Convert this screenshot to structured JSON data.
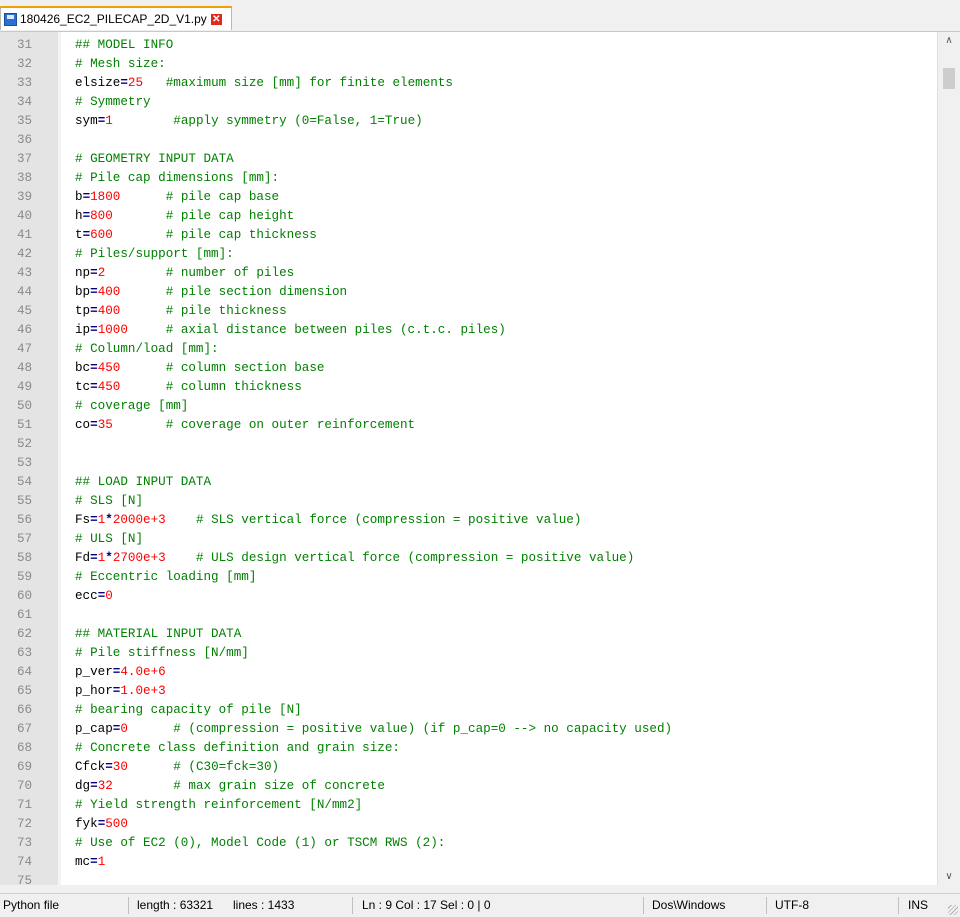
{
  "tab": {
    "filename": "180426_EC2_PILECAP_2D_V1.py"
  },
  "status": {
    "filetype": "Python file",
    "length": "length : 63321",
    "lines": "lines : 1433",
    "position": "Ln : 9    Col : 17    Sel : 0 | 0",
    "eol": "Dos\\Windows",
    "encoding": "UTF-8",
    "mode": "INS"
  },
  "lines": [
    {
      "n": "31",
      "t": [
        [
          "c",
          "## MODEL INFO"
        ]
      ]
    },
    {
      "n": "32",
      "t": [
        [
          "c",
          "# Mesh size:"
        ]
      ]
    },
    {
      "n": "33",
      "t": [
        [
          "t",
          "elsize"
        ],
        [
          "o",
          "="
        ],
        [
          "n",
          "25"
        ],
        [
          "t",
          "   "
        ],
        [
          "c",
          "#maximum size [mm] for finite elements"
        ]
      ]
    },
    {
      "n": "34",
      "t": [
        [
          "c",
          "# Symmetry"
        ]
      ]
    },
    {
      "n": "35",
      "t": [
        [
          "t",
          "sym"
        ],
        [
          "o",
          "="
        ],
        [
          "n",
          "1"
        ],
        [
          "t",
          "        "
        ],
        [
          "c",
          "#apply symmetry (0=False, 1=True)"
        ]
      ]
    },
    {
      "n": "36",
      "t": []
    },
    {
      "n": "37",
      "t": [
        [
          "c",
          "# GEOMETRY INPUT DATA"
        ]
      ]
    },
    {
      "n": "38",
      "t": [
        [
          "c",
          "# Pile cap dimensions [mm]:"
        ]
      ]
    },
    {
      "n": "39",
      "t": [
        [
          "t",
          "b"
        ],
        [
          "o",
          "="
        ],
        [
          "n",
          "1800"
        ],
        [
          "t",
          "      "
        ],
        [
          "c",
          "# pile cap base"
        ]
      ]
    },
    {
      "n": "40",
      "t": [
        [
          "t",
          "h"
        ],
        [
          "o",
          "="
        ],
        [
          "n",
          "800"
        ],
        [
          "t",
          "       "
        ],
        [
          "c",
          "# pile cap height"
        ]
      ]
    },
    {
      "n": "41",
      "t": [
        [
          "t",
          "t"
        ],
        [
          "o",
          "="
        ],
        [
          "n",
          "600"
        ],
        [
          "t",
          "       "
        ],
        [
          "c",
          "# pile cap thickness"
        ]
      ]
    },
    {
      "n": "42",
      "t": [
        [
          "c",
          "# Piles/support [mm]:"
        ]
      ]
    },
    {
      "n": "43",
      "t": [
        [
          "t",
          "np"
        ],
        [
          "o",
          "="
        ],
        [
          "n",
          "2"
        ],
        [
          "t",
          "        "
        ],
        [
          "c",
          "# number of piles"
        ]
      ]
    },
    {
      "n": "44",
      "t": [
        [
          "t",
          "bp"
        ],
        [
          "o",
          "="
        ],
        [
          "n",
          "400"
        ],
        [
          "t",
          "      "
        ],
        [
          "c",
          "# pile section dimension"
        ]
      ]
    },
    {
      "n": "45",
      "t": [
        [
          "t",
          "tp"
        ],
        [
          "o",
          "="
        ],
        [
          "n",
          "400"
        ],
        [
          "t",
          "      "
        ],
        [
          "c",
          "# pile thickness"
        ]
      ]
    },
    {
      "n": "46",
      "t": [
        [
          "t",
          "ip"
        ],
        [
          "o",
          "="
        ],
        [
          "n",
          "1000"
        ],
        [
          "t",
          "     "
        ],
        [
          "c",
          "# axial distance between piles (c.t.c. piles)"
        ]
      ]
    },
    {
      "n": "47",
      "t": [
        [
          "c",
          "# Column/load [mm]:"
        ]
      ]
    },
    {
      "n": "48",
      "t": [
        [
          "t",
          "bc"
        ],
        [
          "o",
          "="
        ],
        [
          "n",
          "450"
        ],
        [
          "t",
          "      "
        ],
        [
          "c",
          "# column section base"
        ]
      ]
    },
    {
      "n": "49",
      "t": [
        [
          "t",
          "tc"
        ],
        [
          "o",
          "="
        ],
        [
          "n",
          "450"
        ],
        [
          "t",
          "      "
        ],
        [
          "c",
          "# column thickness"
        ]
      ]
    },
    {
      "n": "50",
      "t": [
        [
          "c",
          "# coverage [mm]"
        ]
      ]
    },
    {
      "n": "51",
      "t": [
        [
          "t",
          "co"
        ],
        [
          "o",
          "="
        ],
        [
          "n",
          "35"
        ],
        [
          "t",
          "       "
        ],
        [
          "c",
          "# coverage on outer reinforcement"
        ]
      ]
    },
    {
      "n": "52",
      "t": []
    },
    {
      "n": "53",
      "t": []
    },
    {
      "n": "54",
      "t": [
        [
          "c",
          "## LOAD INPUT DATA"
        ]
      ]
    },
    {
      "n": "55",
      "t": [
        [
          "c",
          "# SLS [N]"
        ]
      ]
    },
    {
      "n": "56",
      "t": [
        [
          "t",
          "Fs"
        ],
        [
          "o",
          "="
        ],
        [
          "n",
          "1"
        ],
        [
          "o",
          "*"
        ],
        [
          "n",
          "2000e+3"
        ],
        [
          "t",
          "    "
        ],
        [
          "c",
          "# SLS vertical force (compression = positive value)"
        ]
      ]
    },
    {
      "n": "57",
      "t": [
        [
          "c",
          "# ULS [N]"
        ]
      ]
    },
    {
      "n": "58",
      "t": [
        [
          "t",
          "Fd"
        ],
        [
          "o",
          "="
        ],
        [
          "n",
          "1"
        ],
        [
          "o",
          "*"
        ],
        [
          "n",
          "2700e+3"
        ],
        [
          "t",
          "    "
        ],
        [
          "c",
          "# ULS design vertical force (compression = positive value)"
        ]
      ]
    },
    {
      "n": "59",
      "t": [
        [
          "c",
          "# Eccentric loading [mm]"
        ]
      ]
    },
    {
      "n": "60",
      "t": [
        [
          "t",
          "ecc"
        ],
        [
          "o",
          "="
        ],
        [
          "n",
          "0"
        ]
      ]
    },
    {
      "n": "61",
      "t": []
    },
    {
      "n": "62",
      "t": [
        [
          "c",
          "## MATERIAL INPUT DATA"
        ]
      ]
    },
    {
      "n": "63",
      "t": [
        [
          "c",
          "# Pile stiffness [N/mm]"
        ]
      ]
    },
    {
      "n": "64",
      "t": [
        [
          "t",
          "p_ver"
        ],
        [
          "o",
          "="
        ],
        [
          "n",
          "4.0e+6"
        ]
      ]
    },
    {
      "n": "65",
      "t": [
        [
          "t",
          "p_hor"
        ],
        [
          "o",
          "="
        ],
        [
          "n",
          "1.0e+3"
        ]
      ]
    },
    {
      "n": "66",
      "t": [
        [
          "c",
          "# bearing capacity of pile [N]"
        ]
      ]
    },
    {
      "n": "67",
      "t": [
        [
          "t",
          "p_cap"
        ],
        [
          "o",
          "="
        ],
        [
          "n",
          "0"
        ],
        [
          "t",
          "      "
        ],
        [
          "c",
          "# (compression = positive value) (if p_cap=0 --> no capacity used)"
        ]
      ]
    },
    {
      "n": "68",
      "t": [
        [
          "c",
          "# Concrete class definition and grain size:"
        ]
      ]
    },
    {
      "n": "69",
      "t": [
        [
          "t",
          "Cfck"
        ],
        [
          "o",
          "="
        ],
        [
          "n",
          "30"
        ],
        [
          "t",
          "      "
        ],
        [
          "c",
          "# (C30=fck=30)"
        ]
      ]
    },
    {
      "n": "70",
      "t": [
        [
          "t",
          "dg"
        ],
        [
          "o",
          "="
        ],
        [
          "n",
          "32"
        ],
        [
          "t",
          "        "
        ],
        [
          "c",
          "# max grain size of concrete"
        ]
      ]
    },
    {
      "n": "71",
      "t": [
        [
          "c",
          "# Yield strength reinforcement [N/mm2]"
        ]
      ]
    },
    {
      "n": "72",
      "t": [
        [
          "t",
          "fyk"
        ],
        [
          "o",
          "="
        ],
        [
          "n",
          "500"
        ]
      ]
    },
    {
      "n": "73",
      "t": [
        [
          "c",
          "# Use of EC2 (0), Model Code (1) or TSCM RWS (2):"
        ]
      ]
    },
    {
      "n": "74",
      "t": [
        [
          "t",
          "mc"
        ],
        [
          "o",
          "="
        ],
        [
          "n",
          "1"
        ]
      ]
    },
    {
      "n": "75",
      "t": []
    }
  ]
}
